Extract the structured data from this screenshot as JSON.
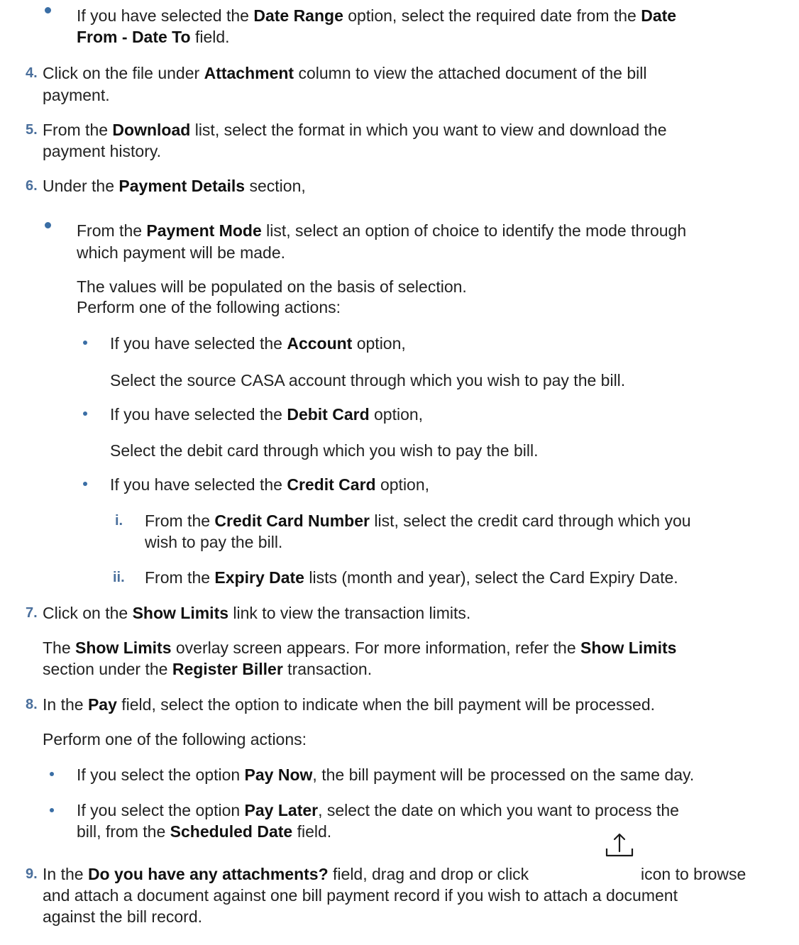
{
  "accent_color": "#4a6f9c",
  "bullet_color": "#3a6ea5",
  "bullet_top": {
    "l1a": "If you have selected the ",
    "l1b": "Date Range",
    "l1c": " option, select the required date from the ",
    "l1d": "Date",
    "l2a": "From - Date To",
    "l2b": " field."
  },
  "step4": {
    "num": "4.",
    "l1a": "Click on the file under ",
    "l1b": "Attachment",
    "l1c": " column to view the attached document of the bill",
    "l2": "payment."
  },
  "step5": {
    "num": "5.",
    "l1a": "From the ",
    "l1b": "Download",
    "l1c": " list, select the format in which you want to view and download the",
    "l2": "payment history."
  },
  "step6": {
    "num": "6.",
    "l1a": "Under the ",
    "l1b": "Payment Details",
    "l1c": " section,",
    "b1a": "From the ",
    "b1b": "Payment Mode",
    "b1c": " list, select an option of choice to identify the mode through",
    "b2": "which payment will be made.",
    "p1": "The values will be populated on the basis of selection.",
    "p2": "Perform one of the following actions:",
    "acc_a": "If you have selected the ",
    "acc_b": "Account",
    "acc_c": " option,",
    "acc_text": "Select the source CASA account through which you wish to pay the bill.",
    "deb_a": "If you have selected the ",
    "deb_b": "Debit Card",
    "deb_c": " option,",
    "deb_text": "Select the debit card through which you wish to pay the bill.",
    "cc_a": "If you have selected the ",
    "cc_b": "Credit Card",
    "cc_c": " option,",
    "i_num": "i.",
    "i1a": "From the ",
    "i1b": "Credit Card Number",
    "i1c": " list, select the credit card through which you",
    "i2": "wish to pay the bill.",
    "ii_num": "ii.",
    "ii_a": "From the ",
    "ii_b": "Expiry Date",
    "ii_c": " lists (month and year), select the Card Expiry Date."
  },
  "step7": {
    "num": "7.",
    "l1a": "Click on the ",
    "l1b": "Show Limits",
    "l1c": " link to view the transaction limits.",
    "p1a": "The ",
    "p1b": "Show Limits",
    "p1c": " overlay screen appears. For more information, refer the ",
    "p1d": "Show Limits",
    "p2a": "section under the ",
    "p2b": "Register Biller",
    "p2c": " transaction."
  },
  "step8": {
    "num": "8.",
    "l1a": "In the ",
    "l1b": "Pay",
    "l1c": " field, select the option to indicate when the bill payment will be processed.",
    "p": "Perform one of the following actions:",
    "now_a": "If you select the option ",
    "now_b": "Pay Now",
    "now_c": ", the bill payment will be processed on the same day.",
    "later_a": "If you select the option ",
    "later_b": "Pay Later",
    "later_c": ", select the date on which you want to process the",
    "later2a": "bill, from the ",
    "later2b": "Scheduled Date",
    "later2c": " field."
  },
  "step9": {
    "num": "9.",
    "l1a": "In the ",
    "l1b": "Do you have any attachments?",
    "l1c": " field, drag and drop or click",
    "l1d": "icon to browse",
    "upload_icon": "upload-icon",
    "l2": "and attach a document against one bill payment record if you wish to attach a document",
    "l3": "against the bill record."
  }
}
